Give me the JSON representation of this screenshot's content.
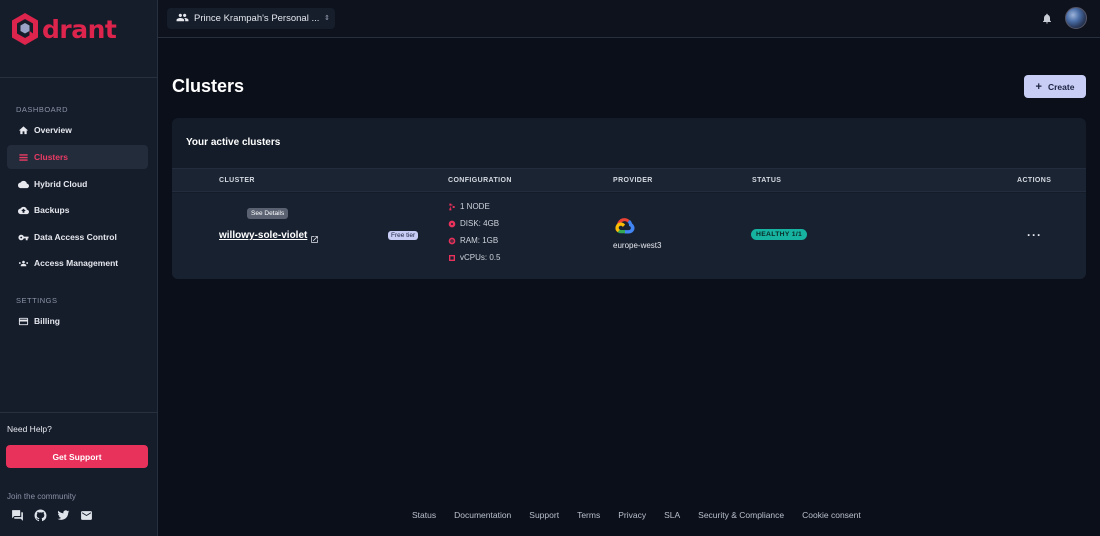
{
  "brand": {
    "logo_text": "drant",
    "accent": "#dc244c"
  },
  "sidebar": {
    "dashboard_label": "DASHBOARD",
    "items": [
      {
        "label": "Overview",
        "icon": "home-icon",
        "active": false
      },
      {
        "label": "Clusters",
        "icon": "list-icon",
        "active": true
      },
      {
        "label": "Hybrid Cloud",
        "icon": "cloud-icon",
        "active": false
      },
      {
        "label": "Backups",
        "icon": "cloud-upload-icon",
        "active": false
      },
      {
        "label": "Data Access Control",
        "icon": "key-icon",
        "active": false
      },
      {
        "label": "Access Management",
        "icon": "group-icon",
        "active": false
      }
    ],
    "settings_label": "SETTINGS",
    "settings_items": [
      {
        "label": "Billing",
        "icon": "credit-card-icon"
      }
    ],
    "help": {
      "label": "Need Help?",
      "button": "Get Support"
    },
    "community": {
      "label": "Join the community",
      "icons": [
        "chat-icon",
        "github-icon",
        "twitter-icon",
        "mail-icon"
      ]
    }
  },
  "topbar": {
    "org_name": "Prince Krampah's Personal ...",
    "icons": [
      "people-icon",
      "unfold-icon",
      "bell-icon",
      "avatar"
    ]
  },
  "main": {
    "title": "Clusters",
    "create_label": "Create",
    "card_title": "Your active clusters",
    "columns": [
      "CLUSTER",
      "CONFIGURATION",
      "PROVIDER",
      "STATUS",
      "ACTIONS"
    ],
    "rows": [
      {
        "name": "willowy-sole-violet",
        "tooltip": "See Details",
        "tier": "Free tier",
        "config": {
          "nodes": "1 NODE",
          "disk": "DISK: 4GB",
          "ram": "RAM: 1GB",
          "vcpus": "vCPUs: 0.5"
        },
        "provider_icon": "google-cloud-icon",
        "provider_region": "europe-west3",
        "status": "HEALTHY 1/1",
        "actions": "···"
      }
    ]
  },
  "footer": {
    "links": [
      "Status",
      "Documentation",
      "Support",
      "Terms",
      "Privacy",
      "SLA",
      "Security & Compliance",
      "Cookie consent"
    ]
  },
  "colors": {
    "background": "#0b0f1a",
    "sidebar": "#151d2b",
    "status_green": "#16b3a1",
    "create_button": "#c7cdf5",
    "support_button": "#e8315b"
  }
}
